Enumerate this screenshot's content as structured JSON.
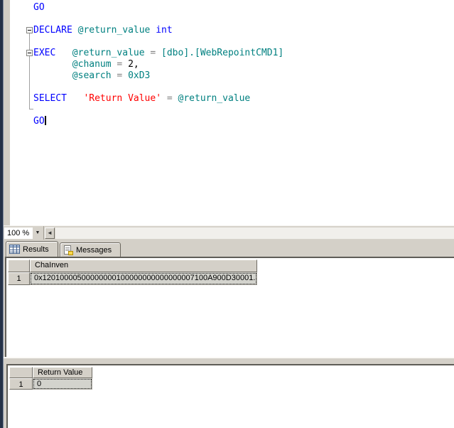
{
  "editor": {
    "token_colors": {
      "kw": "#0000ff",
      "id": "#008080",
      "op": "#808080",
      "num": "#000000",
      "str": "#ff0000",
      "pl": "#000000"
    },
    "lines": [
      [
        {
          "c": "kw",
          "v": "GO"
        }
      ],
      [],
      [
        {
          "c": "kw",
          "v": "DECLARE"
        },
        {
          "c": "pl",
          "v": " "
        },
        {
          "c": "id",
          "v": "@return_value"
        },
        {
          "c": "pl",
          "v": " "
        },
        {
          "c": "kw",
          "v": "int"
        }
      ],
      [],
      [
        {
          "c": "kw",
          "v": "EXEC"
        },
        {
          "c": "pl",
          "v": "   "
        },
        {
          "c": "id",
          "v": "@return_value"
        },
        {
          "c": "pl",
          "v": " "
        },
        {
          "c": "op",
          "v": "="
        },
        {
          "c": "pl",
          "v": " "
        },
        {
          "c": "id",
          "v": "[dbo].[WebRepointCMD1]"
        }
      ],
      [
        {
          "c": "pl",
          "v": "       "
        },
        {
          "c": "id",
          "v": "@chanum"
        },
        {
          "c": "pl",
          "v": " "
        },
        {
          "c": "op",
          "v": "="
        },
        {
          "c": "pl",
          "v": " "
        },
        {
          "c": "num",
          "v": "2"
        },
        {
          "c": "pl",
          "v": ","
        }
      ],
      [
        {
          "c": "pl",
          "v": "       "
        },
        {
          "c": "id",
          "v": "@search"
        },
        {
          "c": "pl",
          "v": " "
        },
        {
          "c": "op",
          "v": "="
        },
        {
          "c": "pl",
          "v": " "
        },
        {
          "c": "id",
          "v": "0xD3"
        }
      ],
      [],
      [
        {
          "c": "kw",
          "v": "SELECT"
        },
        {
          "c": "pl",
          "v": "   "
        },
        {
          "c": "str",
          "v": "'Return Value'"
        },
        {
          "c": "pl",
          "v": " "
        },
        {
          "c": "op",
          "v": "="
        },
        {
          "c": "pl",
          "v": " "
        },
        {
          "c": "id",
          "v": "@return_value"
        }
      ],
      [],
      [
        {
          "c": "kw",
          "v": "GO"
        },
        {
          "c": "caret",
          "v": ""
        }
      ]
    ]
  },
  "status_bar": {
    "zoom_value": "100 %"
  },
  "results_pane": {
    "tabs": [
      {
        "label": "Results",
        "icon": "results-grid-icon",
        "active": true
      },
      {
        "label": "Messages",
        "icon": "messages-doc-icon",
        "active": false
      }
    ]
  },
  "results_grid": {
    "columns": [
      "ChaInven"
    ],
    "rows": [
      {
        "row_number": "1",
        "cells": [
          "0x12010000500000000100000000000000007100A900D30001..."
        ]
      }
    ]
  },
  "return_grid": {
    "columns": [
      "Return Value"
    ],
    "rows": [
      {
        "row_number": "1",
        "cells": [
          "0"
        ]
      }
    ]
  },
  "colors": {
    "keyword_blue": "#0000ff",
    "identifier_teal": "#008080",
    "string_red": "#ff0000",
    "operator_gray": "#808080",
    "panel_gray": "#d4d0c8",
    "dock_navy": "#253248",
    "selected_cell_gray": "#d3d3cd"
  }
}
